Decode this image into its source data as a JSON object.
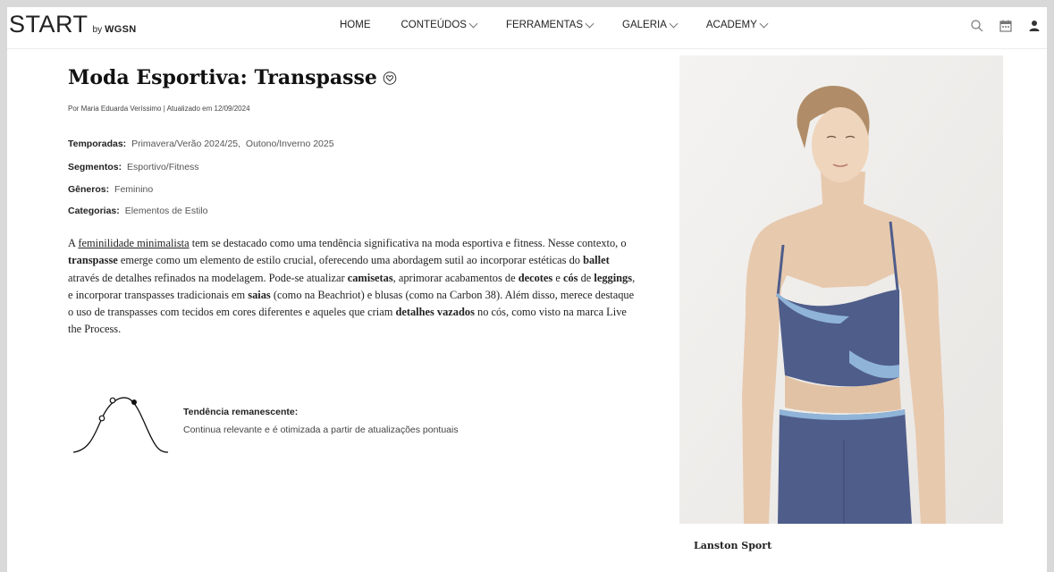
{
  "header": {
    "logo_main": "START",
    "logo_by": "by",
    "logo_brand": "WGSN",
    "nav": [
      {
        "label": "HOME",
        "has_dropdown": false
      },
      {
        "label": "CONTEÚDOS",
        "has_dropdown": true
      },
      {
        "label": "FERRAMENTAS",
        "has_dropdown": true
      },
      {
        "label": "GALERIA",
        "has_dropdown": true
      },
      {
        "label": "ACADEMY",
        "has_dropdown": true
      }
    ],
    "icons": [
      "search-icon",
      "calendar-icon",
      "user-icon"
    ]
  },
  "article": {
    "title": "Moda Esportiva: Transpasse",
    "byline": "Por Maria Eduarda Veríssimo | Atualizado em 12/09/2024",
    "meta": {
      "temporadas_label": "Temporadas:",
      "temporadas_value": "Primavera/Verão 2024/25,  Outono/Inverno 2025",
      "segmentos_label": "Segmentos:",
      "segmentos_value": "Esportivo/Fitness",
      "generos_label": "Gêneros:",
      "generos_value": "Feminino",
      "categorias_label": "Categorias:",
      "categorias_value": "Elementos de Estilo"
    },
    "body": {
      "p1": "A ",
      "link": "feminilidade minimalista",
      "p2": " tem se destacado como uma tendência significativa na moda esportiva e fitness. Nesse contexto, o ",
      "b1": "transpasse",
      "p3": " emerge como um elemento de estilo crucial, oferecendo uma abordagem sutil ao incorporar estéticas do ",
      "b2": "ballet",
      "p4": " através de detalhes refinados na modelagem. Pode-se atualizar ",
      "b3": "camisetas",
      "p5": ", aprimorar acabamentos de ",
      "b4": "decotes",
      "p6": " e ",
      "b5": "cós",
      "p7": " de ",
      "b6": "leggings",
      "p8": ", e incorporar transpasses tradicionais em ",
      "b7": "saias",
      "p9": " (como na Beachriot) e blusas (como na Carbon 38). Além disso, merece destaque o uso de transpasses com tecidos em cores diferentes e aqueles que criam ",
      "b8": "detalhes vazados",
      "p10": " no cós, como visto na marca Live the Process."
    },
    "trend": {
      "title": "Tendência remanescente:",
      "description": "Continua relevante e é otimizada a partir de atualizações pontuais"
    }
  },
  "image": {
    "caption": "Lanston Sport"
  },
  "colors": {
    "outfit": "#4f5d8a",
    "accent_band": "#8fb4d8",
    "page_bg": "#ffffff",
    "frame_bg": "#d9d9d9"
  }
}
